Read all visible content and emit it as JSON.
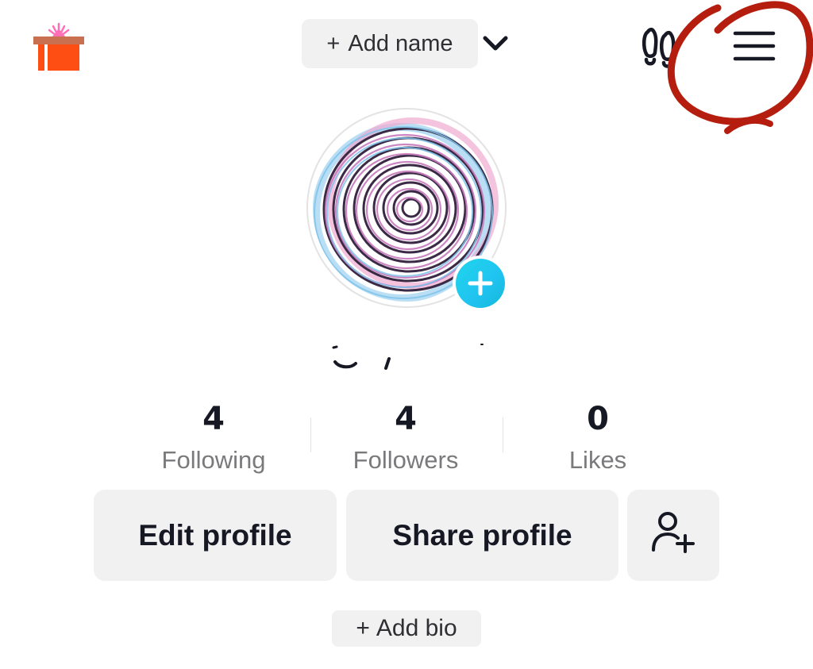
{
  "header": {
    "gift_icon": "gift-icon",
    "add_name_plus": "+",
    "add_name_label": "Add name",
    "account_switch_icon": "chevron-down-icon",
    "footprint_icon": "footprint-icon",
    "menu_icon": "hamburger-menu-icon",
    "annotation_color": "#b51e0f"
  },
  "avatar": {
    "image": "avatar-spiral-drawing",
    "add_icon": "plus-icon",
    "add_color": "#20d5ec"
  },
  "username": {
    "text": ""
  },
  "stats": [
    {
      "value": "4",
      "label": "Following"
    },
    {
      "value": "4",
      "label": "Followers"
    },
    {
      "value": "0",
      "label": "Likes"
    }
  ],
  "actions": {
    "edit_label": "Edit profile",
    "share_label": "Share profile",
    "add_friend_icon": "add-user-icon"
  },
  "bio": {
    "plus": "+",
    "label": "Add bio"
  },
  "colors": {
    "pill_bg": "#f1f1f2",
    "text_primary": "#161823",
    "text_secondary": "#7a7a7d",
    "gift_orange": "#fe4e14",
    "gift_lid": "#c8704f",
    "gift_sparkle": "#ff6fb7"
  }
}
